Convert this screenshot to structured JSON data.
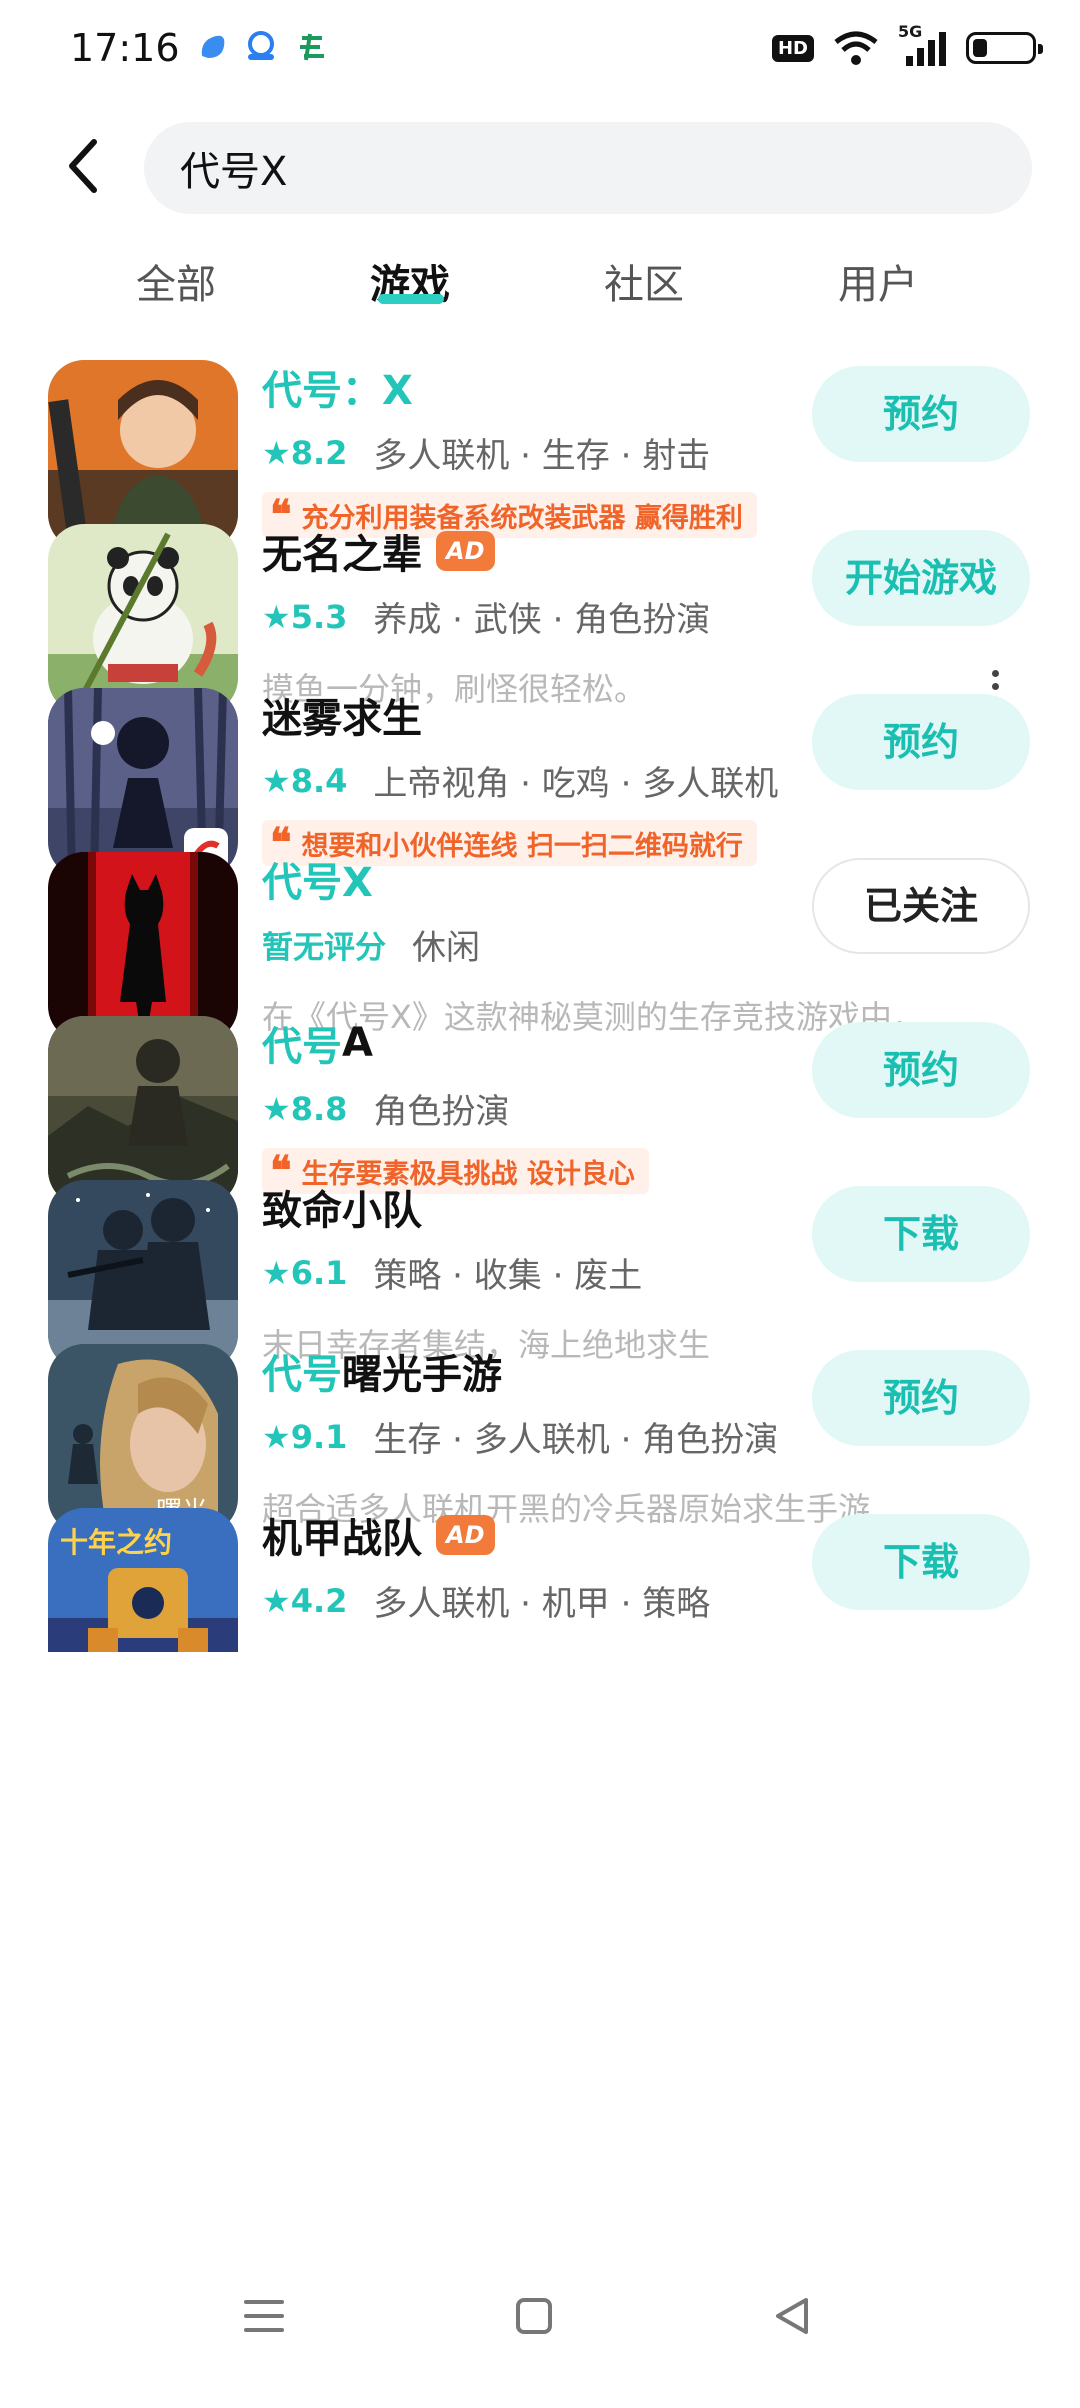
{
  "status_bar": {
    "time": "17:16",
    "app_icons": [
      "blue-app-icon",
      "cloud-app-icon",
      "green-app-icon"
    ],
    "hd": "HD",
    "network": "5G",
    "battery_level": 0.25
  },
  "search": {
    "query": "代号X"
  },
  "tabs": [
    {
      "label": "全部",
      "active": false
    },
    {
      "label": "游戏",
      "active": true
    },
    {
      "label": "社区",
      "active": false
    },
    {
      "label": "用户",
      "active": false
    }
  ],
  "games": [
    {
      "title_hl": "代号：X",
      "title_rest": "",
      "ad": "",
      "score": "★8.2",
      "tags": "多人联机 · 生存 · 射击",
      "quote": "充分利用装备系统改装武器 赢得胜利",
      "desc": "",
      "button": "预约"
    },
    {
      "title_hl": "",
      "title_rest": "无名之辈",
      "ad": "AD",
      "score": "★5.3",
      "tags": "养成 · 武侠 · 角色扮演",
      "quote": "",
      "desc": "摸鱼一分钟，刷怪很轻松。",
      "button": "开始游戏"
    },
    {
      "title_hl": "",
      "title_rest": "迷雾求生",
      "ad": "",
      "score": "★8.4",
      "tags": "上帝视角 · 吃鸡 · 多人联机",
      "quote": "想要和小伙伴连线 扫一扫二维码就行",
      "desc": "",
      "button": "预约"
    },
    {
      "title_hl": "代号X",
      "title_rest": "",
      "ad": "",
      "score": "暂无评分",
      "tags": "休闲",
      "quote": "",
      "desc": "在《代号X》这款神秘莫测的生存竞技游戏中，...",
      "button": "已关注"
    },
    {
      "title_hl": "代号",
      "title_rest": "A",
      "ad": "",
      "score": "★8.8",
      "tags": "角色扮演",
      "quote": "生存要素极具挑战 设计良心",
      "desc": "",
      "button": "预约"
    },
    {
      "title_hl": "",
      "title_rest": "致命小队",
      "ad": "",
      "score": "★6.1",
      "tags": "策略 · 收集 · 废土",
      "quote": "",
      "desc": "末日幸存者集结，海上绝地求生",
      "button": "下载"
    },
    {
      "title_hl": "代号",
      "title_rest": "曙光手游",
      "ad": "",
      "score": "★9.1",
      "tags": "生存 · 多人联机 · 角色扮演",
      "quote": "",
      "desc": "超合适多人联机开黑的冷兵器原始求生手游",
      "button": "预约"
    },
    {
      "title_hl": "",
      "title_rest": "机甲战队",
      "ad": "AD",
      "score": "★4.2",
      "tags": "多人联机 · 机甲 · 策略",
      "quote": "",
      "desc": "",
      "button": "下载"
    }
  ],
  "icon_texts": {
    "shuguang": "曙光",
    "jijia": "十年之约"
  },
  "colors": {
    "accent": "#22c5b8",
    "button_bg": "#e1f8f6",
    "quote_text": "#f0642a",
    "ad_badge": "#f27a3a"
  }
}
